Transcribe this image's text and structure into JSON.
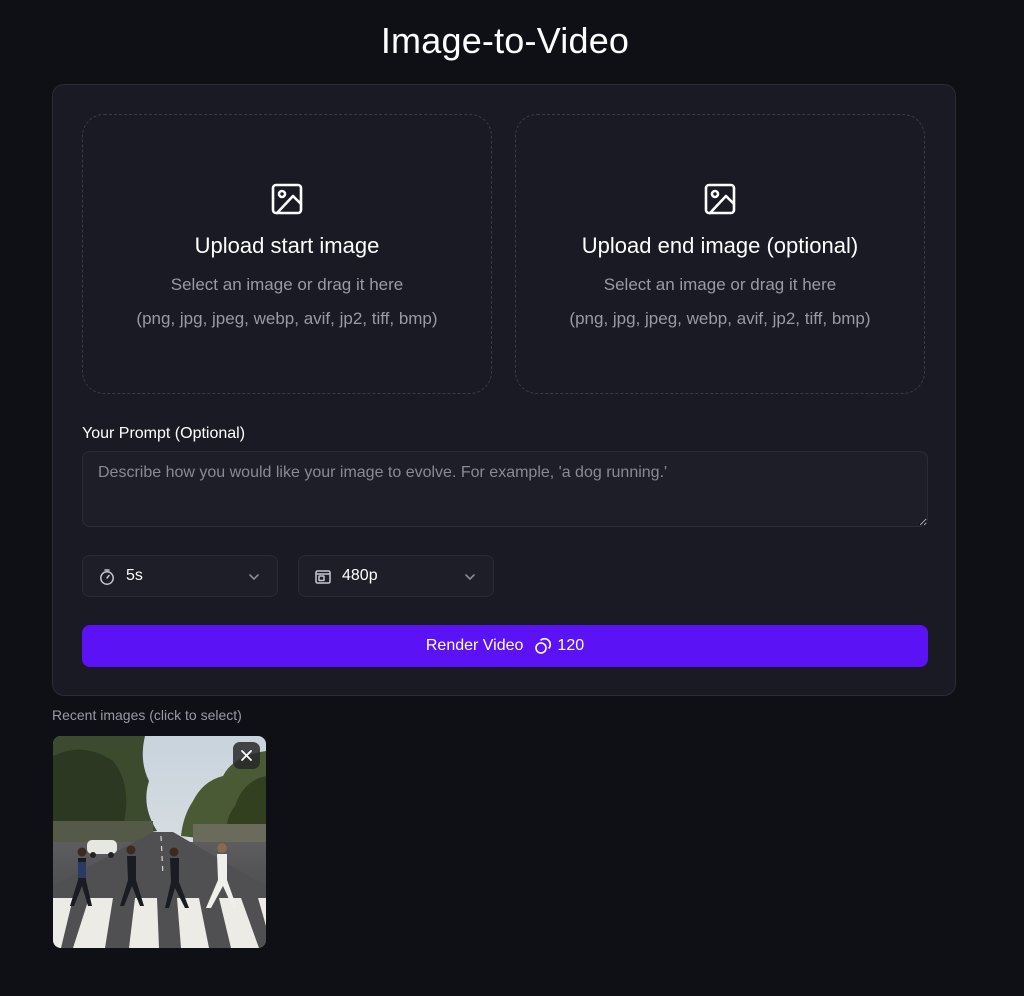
{
  "page": {
    "title": "Image-to-Video"
  },
  "upload": {
    "start": {
      "title": "Upload start image",
      "subtitle": "Select an image or drag it here",
      "formats": "(png, jpg, jpeg, webp, avif, jp2, tiff, bmp)",
      "icon": "image-icon"
    },
    "end": {
      "title": "Upload end image (optional)",
      "subtitle": "Select an image or drag it here",
      "formats": "(png, jpg, jpeg, webp, avif, jp2, tiff, bmp)",
      "icon": "image-icon"
    }
  },
  "prompt": {
    "label": "Your Prompt (Optional)",
    "placeholder": "Describe how you would like your image to evolve. For example, 'a dog running.'",
    "value": ""
  },
  "options": {
    "duration": {
      "value": "5s",
      "icon": "stopwatch-icon"
    },
    "resolution": {
      "value": "480p",
      "icon": "resolution-icon"
    }
  },
  "render": {
    "label": "Render Video",
    "credits": "120",
    "credits_icon": "credits-icon"
  },
  "recent": {
    "label": "Recent images (click to select)",
    "items": [
      {
        "remove_icon": "close-icon"
      }
    ]
  },
  "colors": {
    "background": "#0f0f16",
    "card": "#1a1a24",
    "accent": "#5b12f5",
    "muted_text": "#9a9aa6"
  }
}
